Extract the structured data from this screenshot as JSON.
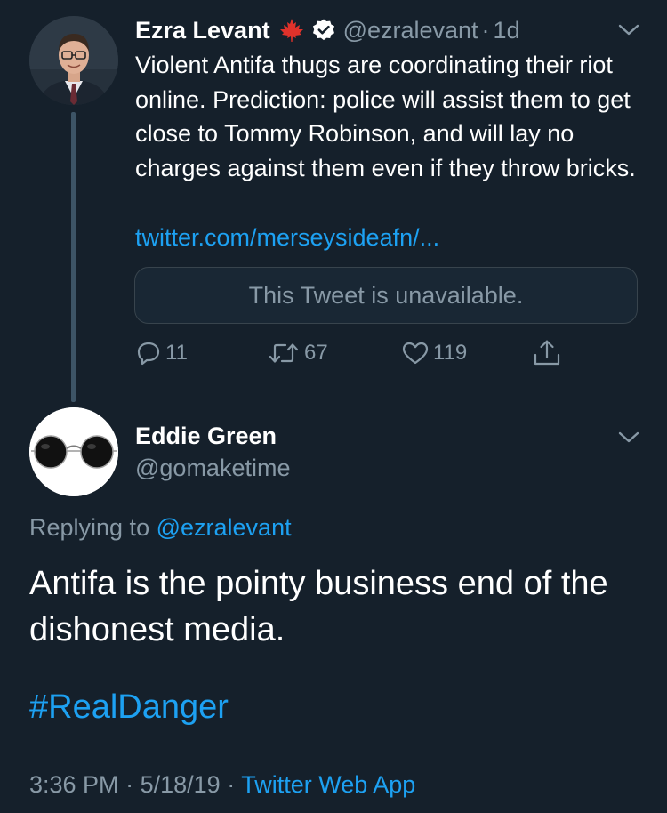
{
  "tweet1": {
    "name": "Ezra Levant",
    "handle": "@ezralevant",
    "separator": "·",
    "time": "1d",
    "text": "Violent Antifa thugs are coordinating their riot online. Prediction: police will assist them to get close to Tommy Robinson, and will lay no charges against them even if they throw bricks.",
    "link": "twitter.com/merseysideafn/...",
    "quoted_unavailable": "This Tweet is unavailable.",
    "stats": {
      "replies": "11",
      "retweets": "67",
      "likes": "119"
    },
    "icons": {
      "badge": "maple-leaf-icon",
      "verified": "verified-badge-icon",
      "menu": "chevron-down-icon",
      "reply": "reply-icon",
      "retweet": "retweet-icon",
      "like": "heart-icon",
      "share": "share-icon"
    }
  },
  "tweet2": {
    "name": "Eddie Green",
    "handle": "@gomaketime",
    "replying_prefix": "Replying to",
    "replying_to": "@ezralevant",
    "text": "Antifa is the pointy business end of the dishonest media.",
    "hashtag": "#RealDanger",
    "time": "3:36 PM",
    "date": "5/18/19",
    "separator": "·",
    "app": "Twitter Web App"
  },
  "colors": {
    "background": "#15202b",
    "secondary_text": "#8899a6",
    "accent": "#1da1f2",
    "border": "#38444d"
  }
}
